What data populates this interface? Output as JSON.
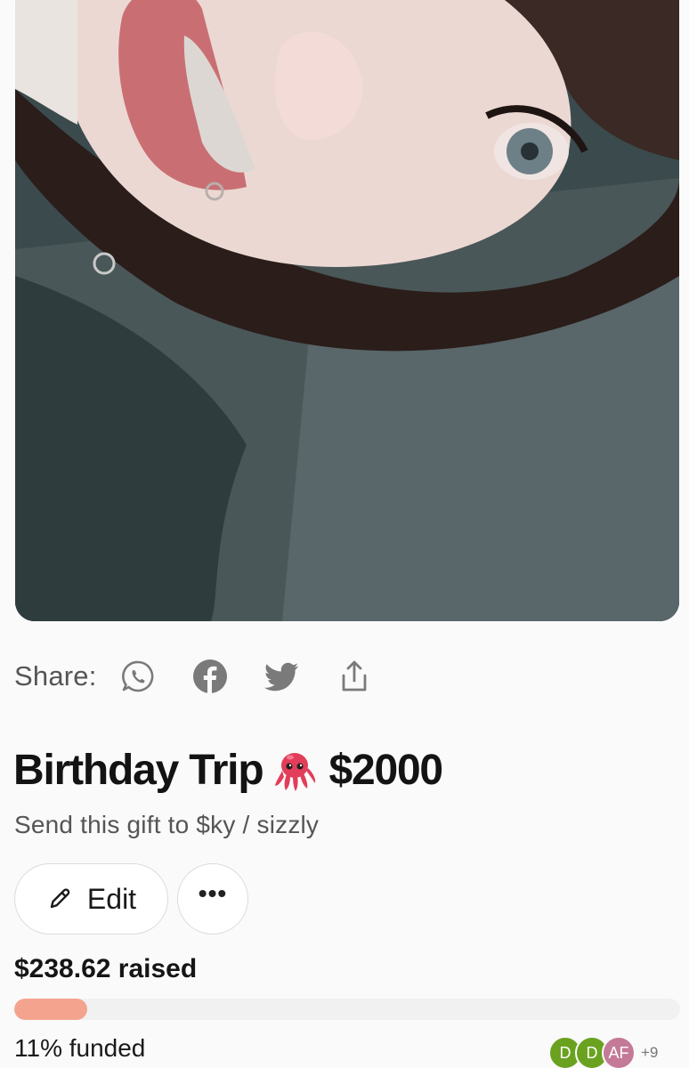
{
  "share": {
    "label": "Share:",
    "icons": [
      "whatsapp-icon",
      "facebook-icon",
      "twitter-icon",
      "share-upload-icon"
    ]
  },
  "gift": {
    "title": "Birthday Trip",
    "emoji_icon": "octopus-emoji",
    "goal": "$2000",
    "subtitle": "Send this gift to $ky / sizzly"
  },
  "actions": {
    "edit_label": "Edit",
    "more_label": "•••"
  },
  "funding": {
    "raised_text": "$238.62 raised",
    "progress_fraction": 0.11,
    "funded_text": "11% funded",
    "progress_color": "#f4a48e"
  },
  "contributors": {
    "avatars": [
      {
        "initials": "D",
        "color": "#6aa21f"
      },
      {
        "initials": "D",
        "color": "#6aa21f"
      },
      {
        "initials": "AF",
        "color": "#c47a97"
      }
    ],
    "more_count": "+9"
  }
}
